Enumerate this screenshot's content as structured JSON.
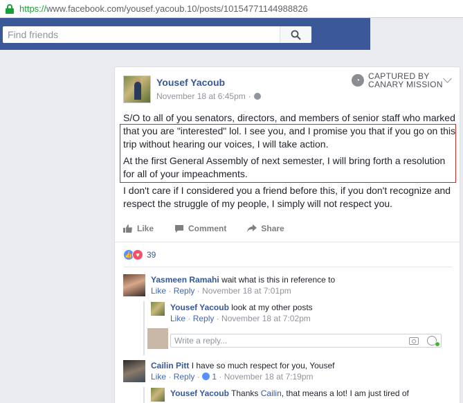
{
  "browser": {
    "url_proto": "https://",
    "url_rest": "www.facebook.com/yousef.yacoub.10/posts/10154771144988826"
  },
  "header": {
    "search_placeholder": "Find friends"
  },
  "post": {
    "author": "Yousef Yacoub",
    "timestamp": "November 18 at 6:45pm",
    "watermark_line1": "CAPTURED BY",
    "watermark_line2": "CANARY MISSION",
    "paragraph1": "S/O to all of you senators, directors, and members of senior staff who marked that you are \"interested\" lol. I see you, and I promise you that if you go on this trip without hearing our voices, I will take action.",
    "paragraph2": "At the first General Assembly of next semester, I will bring forth a resolution for all of your impeachments.",
    "paragraph3": "I don't care if I considered you a friend before this, if you don't recognize and respect the struggle of my people, I simply will not respect you.",
    "actions": {
      "like": "Like",
      "comment": "Comment",
      "share": "Share"
    },
    "reaction_count": "39"
  },
  "comments": [
    {
      "name": "Yasmeen Ramahi",
      "text": "wait what is this in reference to",
      "like": "Like",
      "reply": "Reply",
      "time": "November 18 at 7:01pm"
    },
    {
      "name": "Yousef Yacoub",
      "text": "look at my other posts",
      "like": "Like",
      "reply": "Reply",
      "time": "November 18 at 7:02pm"
    },
    {
      "name": "Cailin Pitt",
      "text": "I have so much respect for you, Yousef",
      "like": "Like",
      "reply": "Reply",
      "likes": "1",
      "time": "November 18 at 7:19pm"
    },
    {
      "name": "Yousef Yacoub",
      "text_pre": "Thanks ",
      "mention": "Cailin",
      "text_post": ", that means a lot! I am just tired of"
    }
  ],
  "reply_box": {
    "placeholder": "Write a reply..."
  },
  "colors": {
    "fb_blue": "#3b5998",
    "link": "#365899",
    "highlight_border": "#c62828"
  }
}
